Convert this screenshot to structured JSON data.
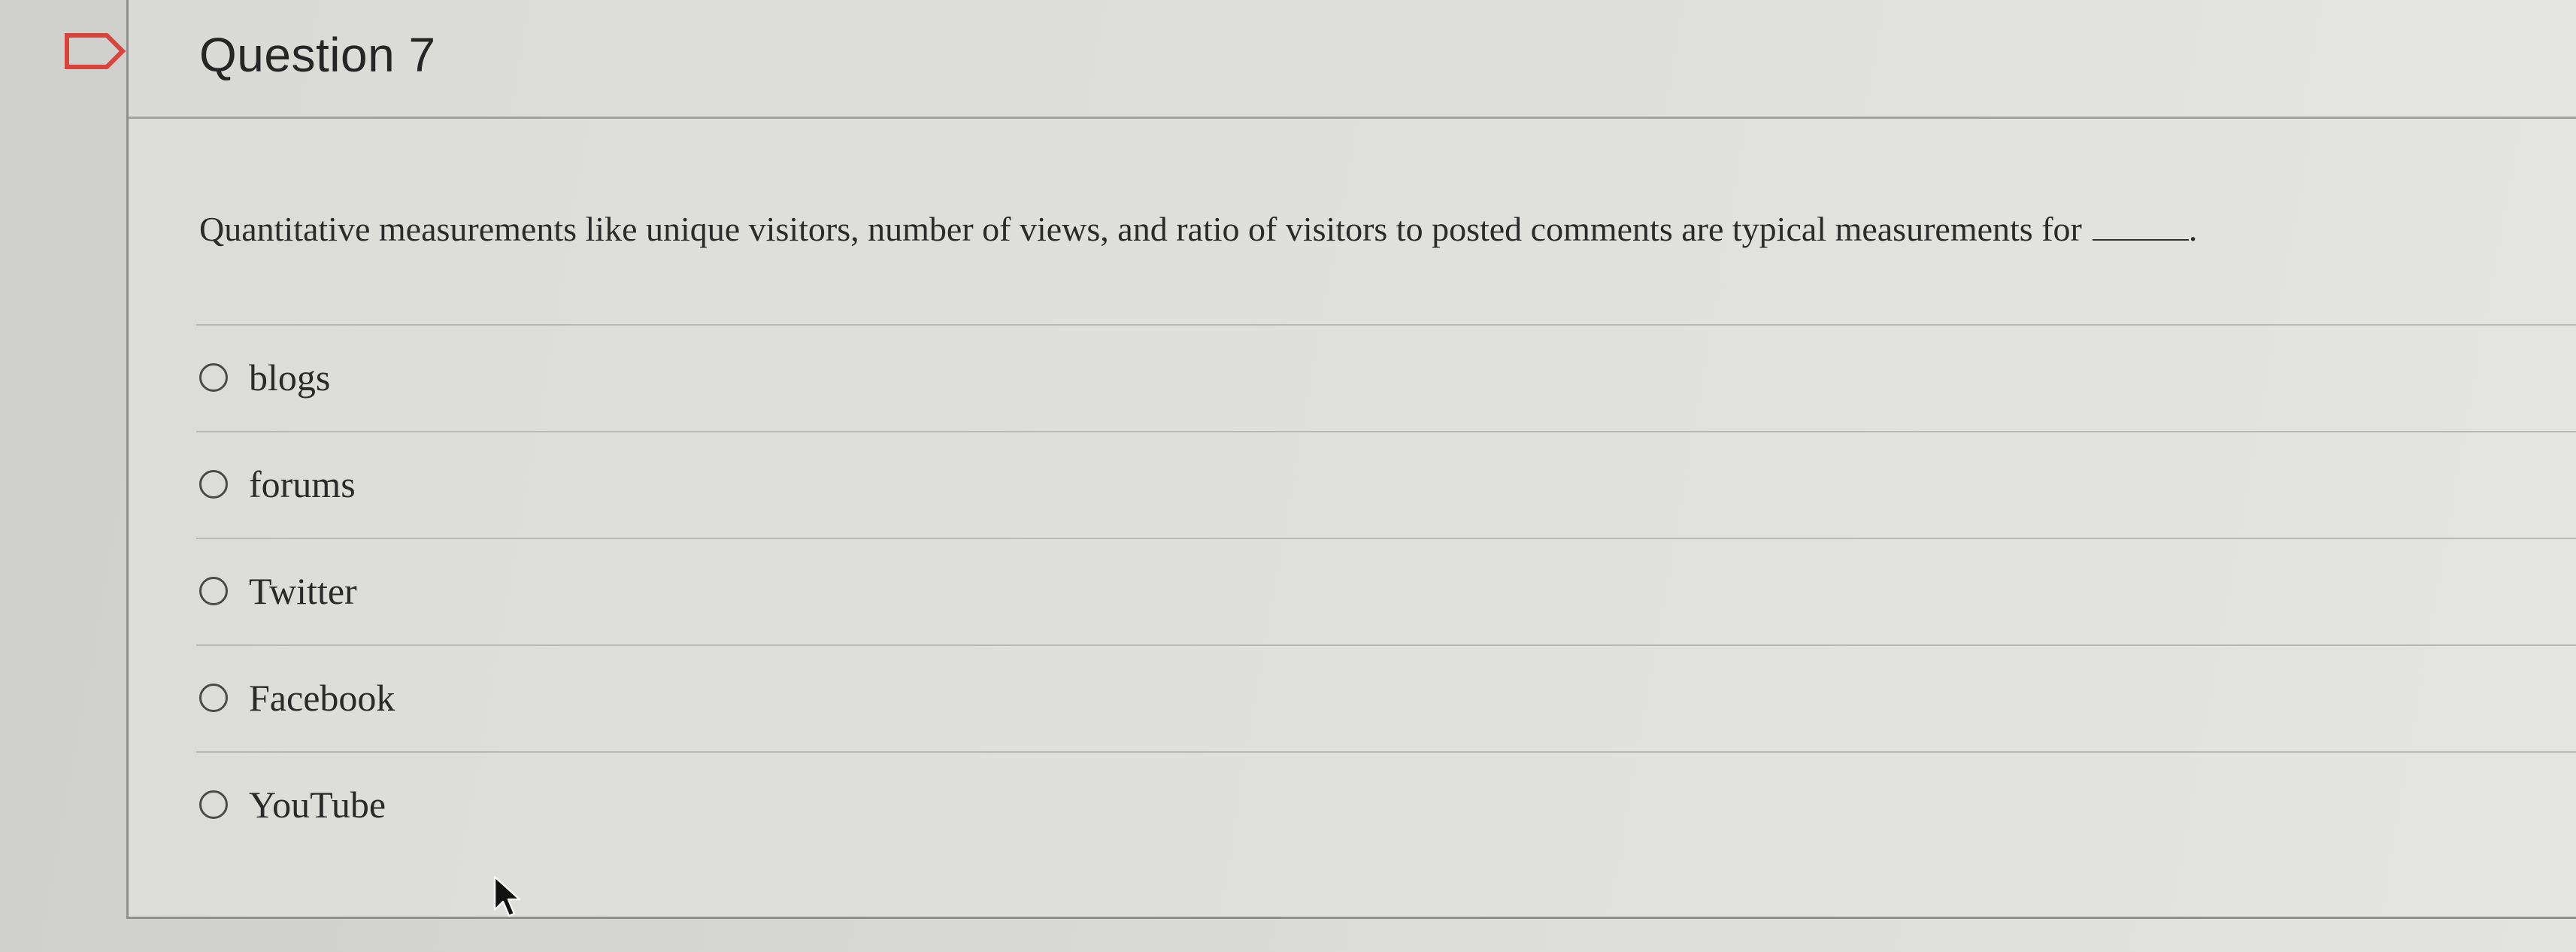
{
  "question": {
    "title": "Question 7",
    "prompt": "Quantitative measurements like unique visitors, number of views, and ratio of visitors to posted comments are typical measurements for",
    "prompt_end": ".",
    "answers": [
      {
        "label": "blogs",
        "selected": false
      },
      {
        "label": "forums",
        "selected": false
      },
      {
        "label": "Twitter",
        "selected": false
      },
      {
        "label": "Facebook",
        "selected": false
      },
      {
        "label": "YouTube",
        "selected": false
      }
    ]
  },
  "icons": {
    "flag": "flag-outline-icon",
    "cursor": "mouse-pointer-icon"
  },
  "colors": {
    "text": "#2a2a2a",
    "border": "#8f8f8c",
    "divider": "#b9b9b6"
  }
}
